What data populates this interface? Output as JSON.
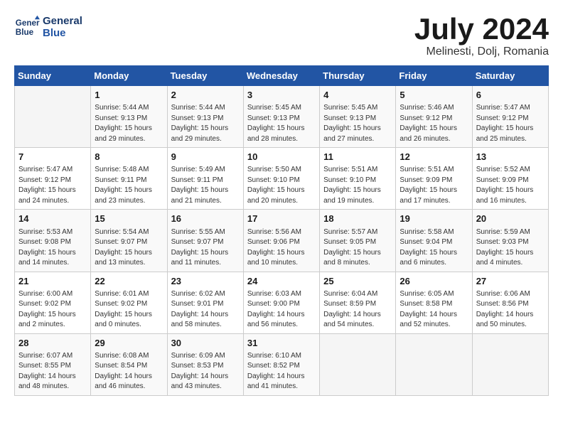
{
  "header": {
    "logo_line1": "General",
    "logo_line2": "Blue",
    "month": "July 2024",
    "location": "Melinesti, Dolj, Romania"
  },
  "columns": [
    "Sunday",
    "Monday",
    "Tuesday",
    "Wednesday",
    "Thursday",
    "Friday",
    "Saturday"
  ],
  "weeks": [
    [
      {
        "date": "",
        "detail": ""
      },
      {
        "date": "1",
        "detail": "Sunrise: 5:44 AM\nSunset: 9:13 PM\nDaylight: 15 hours\nand 29 minutes."
      },
      {
        "date": "2",
        "detail": "Sunrise: 5:44 AM\nSunset: 9:13 PM\nDaylight: 15 hours\nand 29 minutes."
      },
      {
        "date": "3",
        "detail": "Sunrise: 5:45 AM\nSunset: 9:13 PM\nDaylight: 15 hours\nand 28 minutes."
      },
      {
        "date": "4",
        "detail": "Sunrise: 5:45 AM\nSunset: 9:13 PM\nDaylight: 15 hours\nand 27 minutes."
      },
      {
        "date": "5",
        "detail": "Sunrise: 5:46 AM\nSunset: 9:12 PM\nDaylight: 15 hours\nand 26 minutes."
      },
      {
        "date": "6",
        "detail": "Sunrise: 5:47 AM\nSunset: 9:12 PM\nDaylight: 15 hours\nand 25 minutes."
      }
    ],
    [
      {
        "date": "7",
        "detail": "Sunrise: 5:47 AM\nSunset: 9:12 PM\nDaylight: 15 hours\nand 24 minutes."
      },
      {
        "date": "8",
        "detail": "Sunrise: 5:48 AM\nSunset: 9:11 PM\nDaylight: 15 hours\nand 23 minutes."
      },
      {
        "date": "9",
        "detail": "Sunrise: 5:49 AM\nSunset: 9:11 PM\nDaylight: 15 hours\nand 21 minutes."
      },
      {
        "date": "10",
        "detail": "Sunrise: 5:50 AM\nSunset: 9:10 PM\nDaylight: 15 hours\nand 20 minutes."
      },
      {
        "date": "11",
        "detail": "Sunrise: 5:51 AM\nSunset: 9:10 PM\nDaylight: 15 hours\nand 19 minutes."
      },
      {
        "date": "12",
        "detail": "Sunrise: 5:51 AM\nSunset: 9:09 PM\nDaylight: 15 hours\nand 17 minutes."
      },
      {
        "date": "13",
        "detail": "Sunrise: 5:52 AM\nSunset: 9:09 PM\nDaylight: 15 hours\nand 16 minutes."
      }
    ],
    [
      {
        "date": "14",
        "detail": "Sunrise: 5:53 AM\nSunset: 9:08 PM\nDaylight: 15 hours\nand 14 minutes."
      },
      {
        "date": "15",
        "detail": "Sunrise: 5:54 AM\nSunset: 9:07 PM\nDaylight: 15 hours\nand 13 minutes."
      },
      {
        "date": "16",
        "detail": "Sunrise: 5:55 AM\nSunset: 9:07 PM\nDaylight: 15 hours\nand 11 minutes."
      },
      {
        "date": "17",
        "detail": "Sunrise: 5:56 AM\nSunset: 9:06 PM\nDaylight: 15 hours\nand 10 minutes."
      },
      {
        "date": "18",
        "detail": "Sunrise: 5:57 AM\nSunset: 9:05 PM\nDaylight: 15 hours\nand 8 minutes."
      },
      {
        "date": "19",
        "detail": "Sunrise: 5:58 AM\nSunset: 9:04 PM\nDaylight: 15 hours\nand 6 minutes."
      },
      {
        "date": "20",
        "detail": "Sunrise: 5:59 AM\nSunset: 9:03 PM\nDaylight: 15 hours\nand 4 minutes."
      }
    ],
    [
      {
        "date": "21",
        "detail": "Sunrise: 6:00 AM\nSunset: 9:02 PM\nDaylight: 15 hours\nand 2 minutes."
      },
      {
        "date": "22",
        "detail": "Sunrise: 6:01 AM\nSunset: 9:02 PM\nDaylight: 15 hours\nand 0 minutes."
      },
      {
        "date": "23",
        "detail": "Sunrise: 6:02 AM\nSunset: 9:01 PM\nDaylight: 14 hours\nand 58 minutes."
      },
      {
        "date": "24",
        "detail": "Sunrise: 6:03 AM\nSunset: 9:00 PM\nDaylight: 14 hours\nand 56 minutes."
      },
      {
        "date": "25",
        "detail": "Sunrise: 6:04 AM\nSunset: 8:59 PM\nDaylight: 14 hours\nand 54 minutes."
      },
      {
        "date": "26",
        "detail": "Sunrise: 6:05 AM\nSunset: 8:58 PM\nDaylight: 14 hours\nand 52 minutes."
      },
      {
        "date": "27",
        "detail": "Sunrise: 6:06 AM\nSunset: 8:56 PM\nDaylight: 14 hours\nand 50 minutes."
      }
    ],
    [
      {
        "date": "28",
        "detail": "Sunrise: 6:07 AM\nSunset: 8:55 PM\nDaylight: 14 hours\nand 48 minutes."
      },
      {
        "date": "29",
        "detail": "Sunrise: 6:08 AM\nSunset: 8:54 PM\nDaylight: 14 hours\nand 46 minutes."
      },
      {
        "date": "30",
        "detail": "Sunrise: 6:09 AM\nSunset: 8:53 PM\nDaylight: 14 hours\nand 43 minutes."
      },
      {
        "date": "31",
        "detail": "Sunrise: 6:10 AM\nSunset: 8:52 PM\nDaylight: 14 hours\nand 41 minutes."
      },
      {
        "date": "",
        "detail": ""
      },
      {
        "date": "",
        "detail": ""
      },
      {
        "date": "",
        "detail": ""
      }
    ]
  ]
}
